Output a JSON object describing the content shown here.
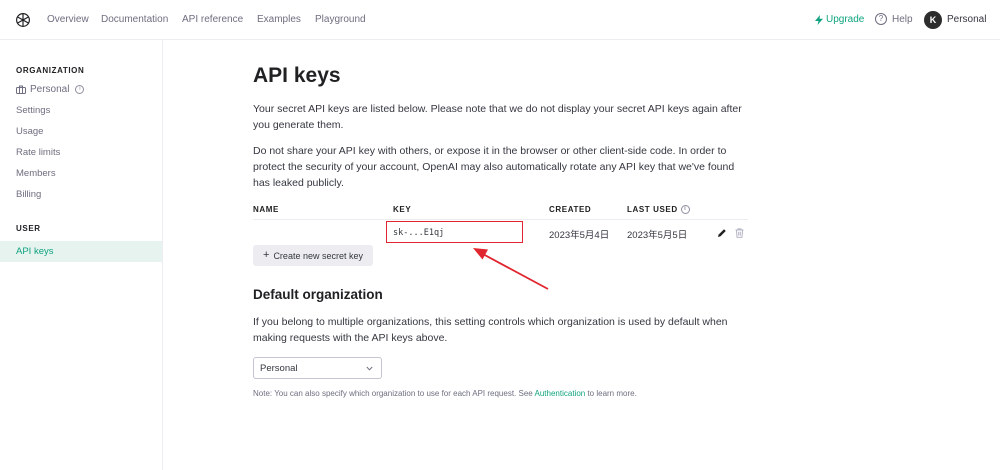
{
  "nav": {
    "links": [
      "Overview",
      "Documentation",
      "API reference",
      "Examples",
      "Playground"
    ],
    "upgrade": "Upgrade",
    "help": "Help",
    "avatar_initial": "K",
    "account": "Personal"
  },
  "sidebar": {
    "org_heading": "ORGANIZATION",
    "org_name": "Personal",
    "org_items": [
      "Settings",
      "Usage",
      "Rate limits",
      "Members",
      "Billing"
    ],
    "user_heading": "USER",
    "active_item": "API keys"
  },
  "main": {
    "title": "API keys",
    "intro": "Your secret API keys are listed below. Please note that we do not display your secret API keys again after you generate them.",
    "warning": "Do not share your API key with others, or expose it in the browser or other client-side code. In order to protect the security of your account, OpenAI may also automatically rotate any API key that we've found has leaked publicly.",
    "table": {
      "headers": {
        "name": "NAME",
        "key": "KEY",
        "created": "CREATED",
        "last_used": "LAST USED"
      },
      "rows": [
        {
          "name": "",
          "key": "sk-...E1qj",
          "created": "2023年5月4日",
          "last_used": "2023年5月5日"
        }
      ]
    },
    "create_button": "Create new secret key",
    "default_org_title": "Default organization",
    "default_org_text": "If you belong to multiple organizations, this setting controls which organization is used by default when making requests with the API keys above.",
    "org_select_value": "Personal",
    "note_prefix": "Note: You can also specify which organization to use for each API request. See ",
    "note_link": "Authentication",
    "note_suffix": " to learn more."
  },
  "colors": {
    "accent": "#10a37f",
    "highlight": "#e0262f"
  },
  "icons": [
    "openai-logo-icon",
    "bolt-icon",
    "help-icon",
    "briefcase-icon",
    "info-icon",
    "pencil-icon",
    "trash-icon",
    "plus-icon",
    "chevron-down-icon",
    "annotation-arrow-icon"
  ]
}
